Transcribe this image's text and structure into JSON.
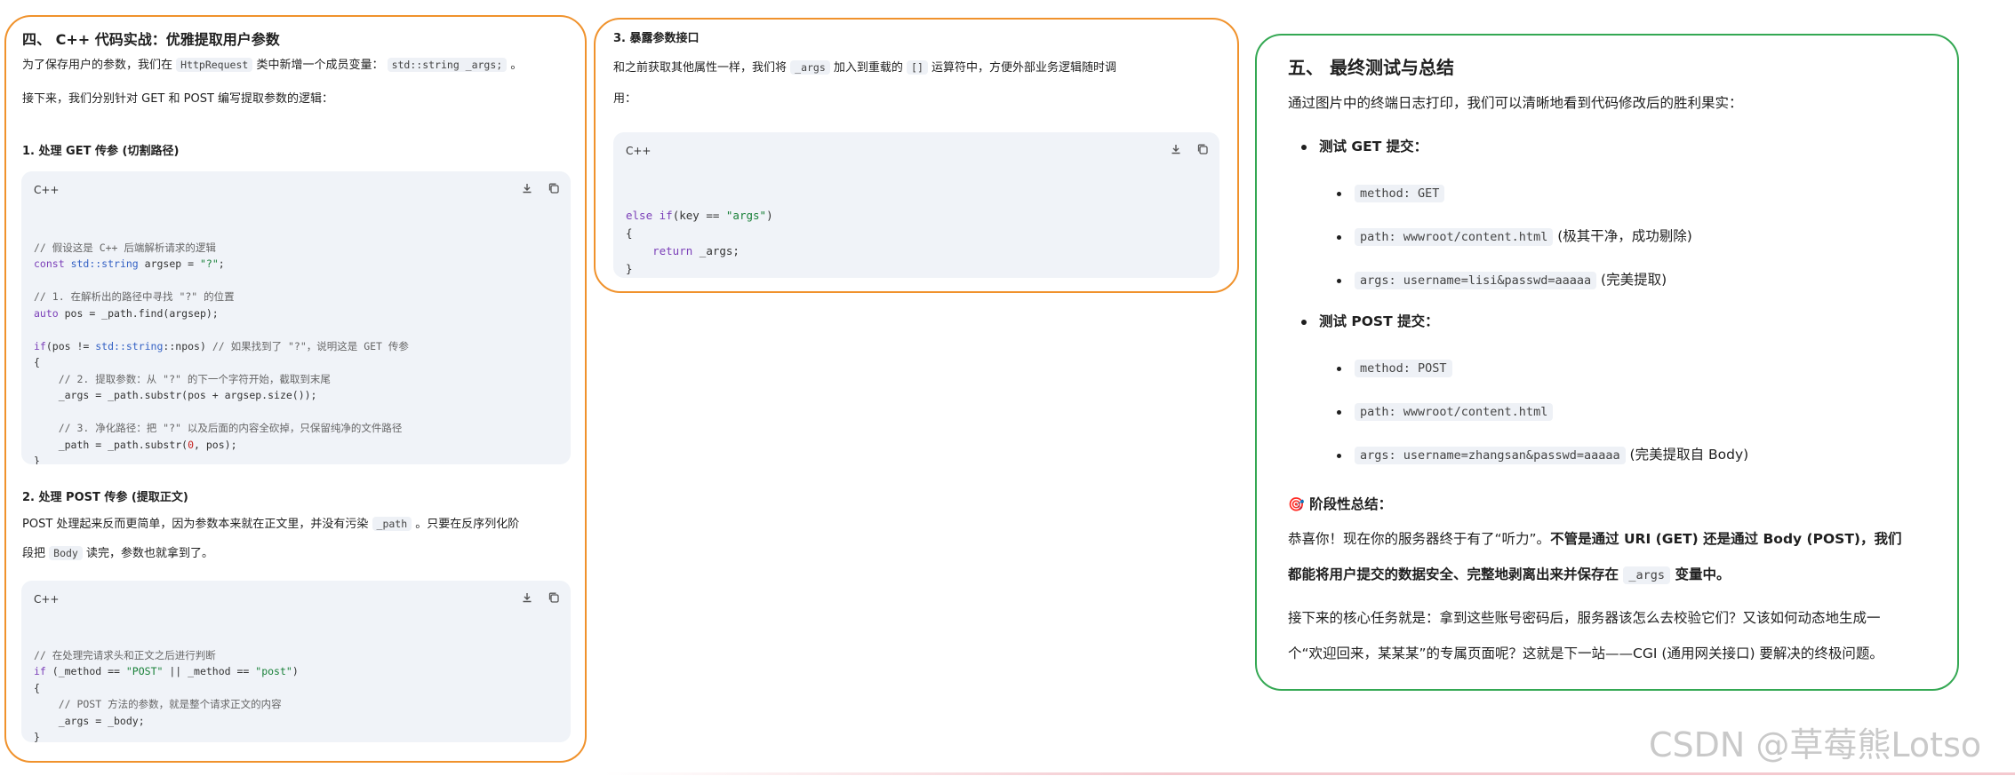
{
  "panel1": {
    "heading": "四、 C++ 代码实战：优雅提取用户参数",
    "intro_pre": "为了保存用户的参数，我们在 ",
    "intro_code1": "HttpRequest",
    "intro_mid": " 类中新增一个成员变量： ",
    "intro_code2": "std::string _args;",
    "intro_post": " 。",
    "next_line": "接下来，我们分别针对 GET 和 POST 编写提取参数的逻辑：",
    "get_heading": "1. 处理 GET 传参 (切割路径)",
    "get_lang": "C++",
    "get_code": [
      "// 假设这是 C++ 后端解析请求的逻辑",
      "const std::string argsep = \"?\";",
      "",
      "// 1. 在解析出的路径中寻找 \"?\" 的位置",
      "auto pos = _path.find(argsep);",
      "",
      "if(pos != std::string::npos) // 如果找到了 \"?\"，说明这是 GET 传参",
      "{",
      "    // 2. 提取参数：从 \"?\" 的下一个字符开始，截取到末尾",
      "    _args = _path.substr(pos + argsep.size());",
      "",
      "    // 3. 净化路径：把 \"?\" 以及后面的内容全砍掉，只保留纯净的文件路径",
      "    _path = _path.substr(0, pos);",
      "}"
    ],
    "post_heading": "2. 处理 POST 传参 (提取正文)",
    "post_text1_pre": "POST 处理起来反而更简单，因为参数本来就在正文里，并没有污染 ",
    "post_text1_code": "_path",
    "post_text1_post": " 。只要在反序列化阶",
    "post_text2_pre": "段把 ",
    "post_text2_code": "Body",
    "post_text2_post": " 读完，参数也就拿到了。",
    "post_lang": "C++",
    "post_code": [
      "// 在处理完请求头和正文之后进行判断",
      "if (_method == \"POST\" || _method == \"post\")",
      "{",
      "    // POST 方法的参数，就是整个请求正文的内容",
      "    _args = _body;",
      "}"
    ]
  },
  "panel2": {
    "heading": "3. 暴露参数接口",
    "text1_pre": "和之前获取其他属性一样，我们将 ",
    "text1_code1": "_args",
    "text1_mid": " 加入到重载的 ",
    "text1_code2": "[]",
    "text1_post": " 运算符中，方便外部业务逻辑随时调",
    "text2": "用：",
    "lang": "C++",
    "code": [
      "else if(key == \"args\")",
      "{",
      "    return _args;",
      "}"
    ]
  },
  "panel3": {
    "heading": "五、 最终测试与总结",
    "intro": "通过图片中的终端日志打印，我们可以清晰地看到代码修改后的胜利果实：",
    "get_title": "测试 GET 提交：",
    "get_items": [
      {
        "code": "method: GET",
        "note": ""
      },
      {
        "code": "path: wwwroot/content.html",
        "note": " (极其干净，成功剔除)"
      },
      {
        "code": "args: username=lisi&passwd=aaaaa",
        "note": " (完美提取)"
      }
    ],
    "post_title": "测试 POST 提交：",
    "post_items": [
      {
        "code": "method: POST",
        "note": ""
      },
      {
        "code": "path: wwwroot/content.html",
        "note": ""
      },
      {
        "code": "args: username=zhangsan&passwd=aaaaa",
        "note": " (完美提取自 Body)"
      }
    ],
    "summary_icon": "🎯",
    "summary_title": "阶段性总结：",
    "summary1_pre": "恭喜你！现在你的服务器终于有了“听力”。",
    "summary1_bold": "不管是通过 URI (GET) 还是通过 Body (POST)，我们",
    "summary2_bold_pre": "都能将用户提交的数据安全、完整地剥离出来并保存在 ",
    "summary2_code": "_args",
    "summary2_bold_post": " 变量中。",
    "next1": "接下来的核心任务就是：拿到这些账号密码后，服务器该怎么去校验它们？又该如何动态地生成一",
    "next2": "个“欢迎回来，某某某”的专属页面呢？这就是下一站——CGI (通用网关接口) 要解决的终极问题。"
  },
  "watermark": "CSDN @草莓熊Lotso",
  "icons": [
    "download-icon",
    "copy-icon"
  ]
}
